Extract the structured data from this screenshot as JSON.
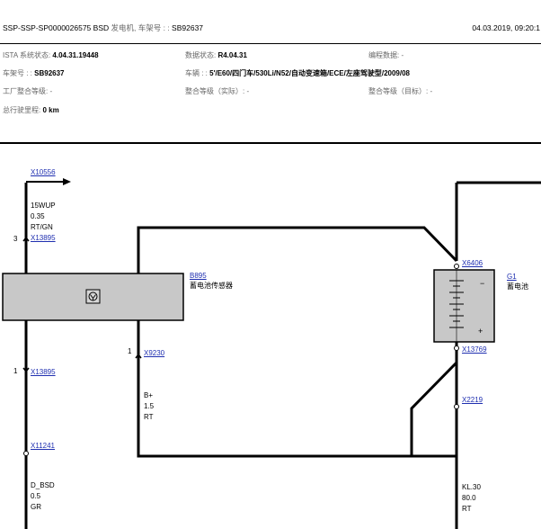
{
  "header": {
    "title_prefix": "SSP-SSP-SP0000026575 BSD ",
    "title_cn": "发电机, 车架号 : : ",
    "title_vin": "SB92637",
    "datetime": "04.03.2019, 09:20:1"
  },
  "info": {
    "ista_label": "ISTA 系统状态: ",
    "ista_value": "4.04.31.19448",
    "data_label": "数据状态: ",
    "data_value": "R4.04.31",
    "prog_label": "编程数据: -",
    "vin_label": "车架号 : : ",
    "vin_value": "SB92637",
    "vehicle_label": "车辆 : : ",
    "vehicle_value": "5'/E60/四门车/530Li/N52/自动变速箱/ECE/左座驾驶型/2009/08",
    "factory_level": "工厂整合等级: -",
    "actual_level": "整合等级（实际）: -",
    "target_level": "整合等级（目标）: -",
    "mileage_label": "总行驶里程: ",
    "mileage_value": "0 km"
  },
  "diagram": {
    "conn_x10556": "X10556",
    "wire1_code": "15WUP",
    "wire1_size": "0.35",
    "wire1_color": "RT/GN",
    "pin3": "3",
    "conn_x13895_top": "X13895",
    "sensor_id": "B895",
    "sensor_name": "蓄电池传感器",
    "pin1_left": "1",
    "conn_x13895_bottom": "X13895",
    "pin1_mid": "1",
    "conn_x9230": "X9230",
    "wire_bplus_code": "B+",
    "wire_bplus_size": "1.5",
    "wire_bplus_color": "RT",
    "conn_x11241": "X11241",
    "wire_bsd_code": "D_BSD",
    "wire_bsd_size": "0.5",
    "wire_bsd_color": "GR",
    "conn_x6406": "X6406",
    "battery_id": "G1",
    "battery_name": "蓄电池",
    "battery_minus": "−",
    "battery_plus": "+",
    "conn_x13769": "X13769",
    "conn_x2219": "X2219",
    "wire_kl30_code": "KL.30",
    "wire_kl30_size": "80.0",
    "wire_kl30_color": "RT"
  }
}
